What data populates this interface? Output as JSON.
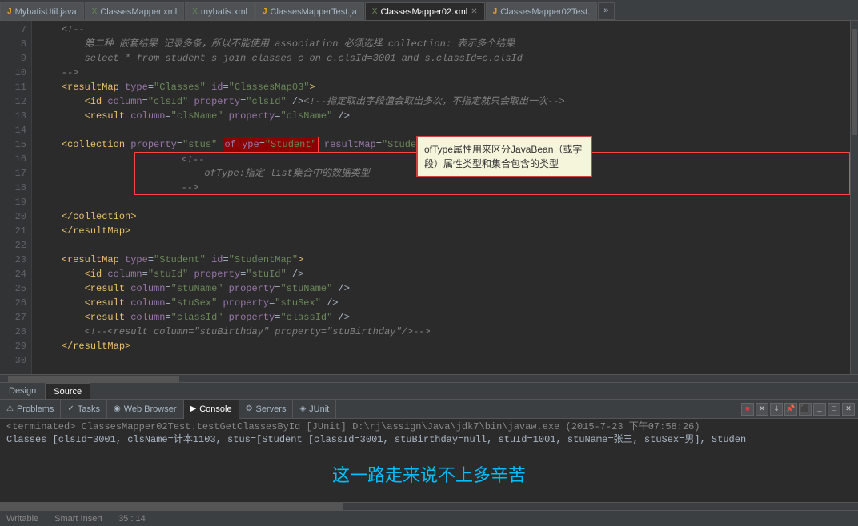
{
  "tabs": [
    {
      "label": "MybatisUtil.java",
      "type": "java",
      "active": false,
      "closable": false
    },
    {
      "label": "ClassesMapper.xml",
      "type": "xml",
      "active": false,
      "closable": false
    },
    {
      "label": "mybatis.xml",
      "type": "xml",
      "active": false,
      "closable": false
    },
    {
      "label": "ClassesMapperTest.ja",
      "type": "java",
      "active": false,
      "closable": false
    },
    {
      "label": "ClassesMapper02.xml",
      "type": "xml",
      "active": true,
      "closable": true
    },
    {
      "label": "ClassesMapper02Test.",
      "type": "java",
      "active": false,
      "closable": false
    }
  ],
  "tab_more": "»",
  "code_lines": [
    {
      "num": "7",
      "content": "    <!--"
    },
    {
      "num": "8",
      "content": "        第二种 嵌套结果 记录多条，所以不能使用 association 必须选择 collection: 表示多个结果"
    },
    {
      "num": "9",
      "content": "        select * from student s join classes c on c.clsId=3001 and s.classId=c.clsId"
    },
    {
      "num": "10",
      "content": "    -->"
    },
    {
      "num": "11",
      "content": "    <resultMap type=\"Classes\" id=\"ClassesMap03\">"
    },
    {
      "num": "12",
      "content": "        <id column=\"clsId\" property=\"clsId\" /><!--指定取出字段值会取出多次，不指定就只会取出一次-->"
    },
    {
      "num": "13",
      "content": "        <result column=\"clsName\" property=\"clsName\" />"
    },
    {
      "num": "14",
      "content": ""
    },
    {
      "num": "15",
      "content": "    <collection property=\"stus\" ofType=\"Student\" resultMap=\"StudentMap\">"
    },
    {
      "num": "16",
      "content": "        <!--"
    },
    {
      "num": "17",
      "content": "            ofType:指定 list集合中的数据类型"
    },
    {
      "num": "18",
      "content": "        -->"
    },
    {
      "num": "19",
      "content": ""
    },
    {
      "num": "20",
      "content": "    </collection>"
    },
    {
      "num": "21",
      "content": "    </resultMap>"
    },
    {
      "num": "22",
      "content": ""
    },
    {
      "num": "23",
      "content": "    <resultMap type=\"Student\" id=\"StudentMap\">"
    },
    {
      "num": "24",
      "content": "        <id column=\"stuId\" property=\"stuId\" />"
    },
    {
      "num": "25",
      "content": "        <result column=\"stuName\" property=\"stuName\" />"
    },
    {
      "num": "26",
      "content": "        <result column=\"stuSex\" property=\"stuSex\" />"
    },
    {
      "num": "27",
      "content": "        <result column=\"classId\" property=\"classId\" />"
    },
    {
      "num": "28",
      "content": "        <!--<result column=\"stuBirthday\" property=\"stuBirthday\"/>-->"
    },
    {
      "num": "29",
      "content": "    </resultMap>"
    },
    {
      "num": "30",
      "content": ""
    }
  ],
  "annotation": {
    "red_box_label": "ofType=\"Student\"",
    "tooltip_text": "ofType属性用来区分JavaBean（或字段）属性类型和集合包含的类型",
    "comment_box_text": "ofType:指定 list集合中的数据类型"
  },
  "design_source": {
    "design_label": "Design",
    "source_label": "Source",
    "active": "Source"
  },
  "bottom_tabs": [
    {
      "label": "Problems",
      "icon": "⚠",
      "active": false
    },
    {
      "label": "Tasks",
      "icon": "✓",
      "active": false
    },
    {
      "label": "Web Browser",
      "icon": "🌐",
      "active": false
    },
    {
      "label": "Console",
      "icon": "▶",
      "active": true
    },
    {
      "label": "Servers",
      "icon": "⚙",
      "active": false
    },
    {
      "label": "JUnit",
      "icon": "◈",
      "active": false
    }
  ],
  "console": {
    "terminated_line": "<terminated> ClassesMapper02Test.testGetClassesById [JUnit] D:\\rj\\assign\\Java\\jdk7\\bin\\javaw.exe (2015-7-23 下午07:58:26)",
    "output_line": "Classes [clsId=3001, clsName=计本1103, stus=[Student [classId=3001, stuBirthday=null, stuId=1001, stuName=张三, stuSex=男], Studen"
  },
  "watermark": "这一路走来说不上多辛苦",
  "status_bar": {
    "writable": "Writable",
    "smart_insert": "Smart Insert",
    "position": "35 : 14"
  }
}
